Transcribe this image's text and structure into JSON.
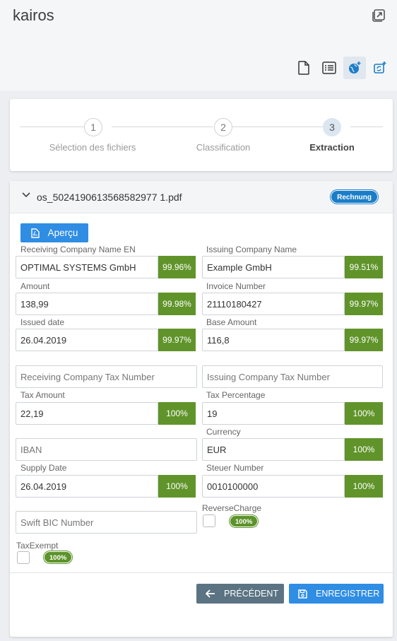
{
  "app": {
    "title": "kairos"
  },
  "toolbar": {
    "items": [
      "document-icon",
      "list-icon",
      "globe-icon",
      "refresh-icon"
    ]
  },
  "stepper": {
    "steps": [
      {
        "number": "1",
        "label": "Sélection des fichiers"
      },
      {
        "number": "2",
        "label": "Classification"
      },
      {
        "number": "3",
        "label": "Extraction"
      }
    ]
  },
  "file": {
    "name": "os_5024190613568582977 1.pdf",
    "tag": "Rechnung"
  },
  "preview": {
    "label": "Aperçu"
  },
  "fields": {
    "receiving_name": {
      "label": "Receiving Company Name EN",
      "value": "OPTIMAL SYSTEMS GmbH",
      "confidence": "99.96%"
    },
    "issuing_name": {
      "label": "Issuing Company Name",
      "value": "Example GmbH",
      "confidence": "99.51%"
    },
    "amount": {
      "label": "Amount",
      "value": "138,99",
      "confidence": "99.98%"
    },
    "invoice_number": {
      "label": "Invoice Number",
      "value": "21110180427",
      "confidence": "99.97%"
    },
    "issued_date": {
      "label": "Issued date",
      "value": "26.04.2019",
      "confidence": "99.97%"
    },
    "base_amount": {
      "label": "Base Amount",
      "value": "116,8",
      "confidence": "99.97%"
    },
    "receiving_tax": {
      "placeholder": "Receiving Company Tax Number"
    },
    "issuing_tax": {
      "placeholder": "Issuing Company Tax Number"
    },
    "tax_amount": {
      "label": "Tax Amount",
      "value": "22,19",
      "confidence": "100%"
    },
    "tax_percentage": {
      "label": "Tax Percentage",
      "value": "19",
      "confidence": "100%"
    },
    "iban": {
      "placeholder": "IBAN"
    },
    "currency": {
      "label": "Currency",
      "value": "EUR",
      "confidence": "100%"
    },
    "supply_date": {
      "label": "Supply Date",
      "value": "26.04.2019",
      "confidence": "100%"
    },
    "steuer_number": {
      "label": "Steuer Number",
      "value": "0010100000",
      "confidence": "100%"
    },
    "swift": {
      "placeholder": "Swift BIC Number"
    },
    "reverse_charge": {
      "label": "ReverseCharge",
      "confidence": "100%"
    },
    "tax_exempt": {
      "label": "TaxExempt",
      "confidence": "100%"
    }
  },
  "actions": {
    "previous": "PRÉCÉDENT",
    "save": "ENREGISTRER"
  },
  "colors": {
    "accent": "#2f8de4",
    "confidence": "#60942a",
    "tag": "#1b7dc8",
    "secondary": "#5b7383"
  }
}
